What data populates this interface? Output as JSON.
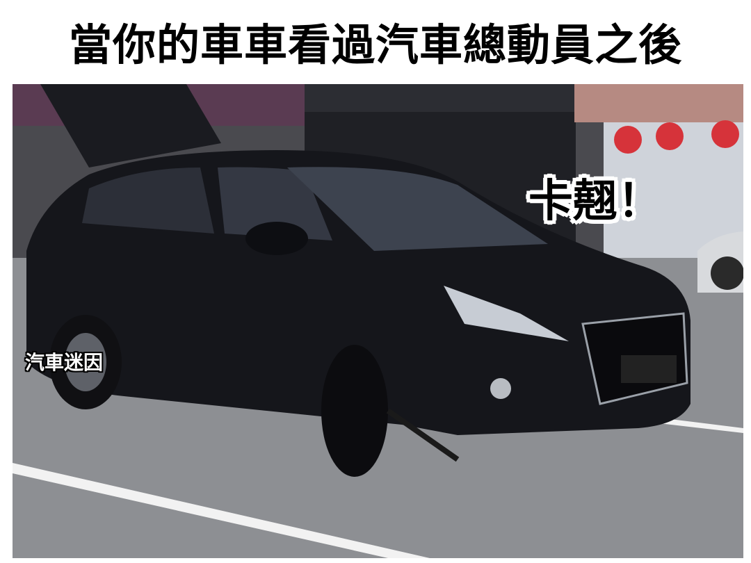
{
  "caption": "當你的車車看過汽車總動員之後",
  "exclaim": "卡翹！",
  "watermark": "汽車迷因",
  "photo": {
    "description_icon": "car-photo",
    "colors": {
      "road": "#8d8f93",
      "car_body": "#15161b",
      "storefront": "#3a3a3e",
      "awning": "#b68a82",
      "lantern": "#d6333a"
    }
  }
}
